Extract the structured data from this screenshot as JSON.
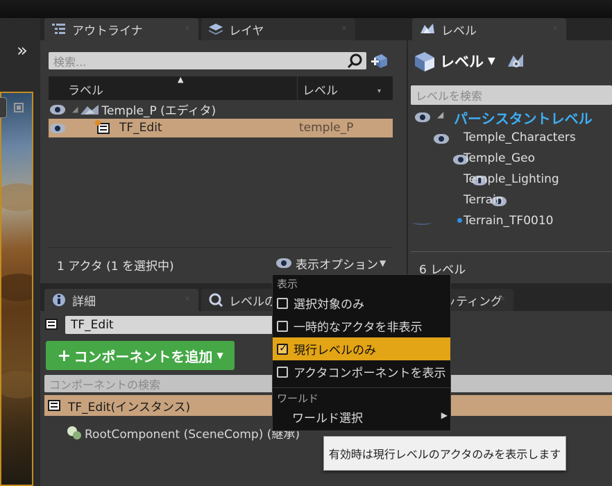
{
  "outliner": {
    "tab_label": "アウトライナ",
    "layers_tab_label": "レイヤ",
    "search_placeholder": "検索...",
    "columns": {
      "label": "ラベル",
      "level": "レベル"
    },
    "tree": {
      "root_label": "Temple_P (エディタ)",
      "selected_item": {
        "label": "TF_Edit",
        "level": "temple_P"
      }
    },
    "status_text": "1 アクタ (1 を選択中)",
    "view_options_label": "表示オプション"
  },
  "levels": {
    "tab_label": "レベル",
    "dropdown_label": "レベル",
    "search_placeholder": "レベルを検索",
    "persistent_level": "パーシスタントレベル",
    "items": [
      "Temple_Characters",
      "Temple_Geo",
      "Temple_Lighting",
      "Terrain",
      "Terrain_TF0010"
    ],
    "count_text": "6 レベル"
  },
  "details": {
    "tab_label": "詳細",
    "level_tab_label": "レベルの",
    "third_tab_label": "ッティング",
    "name_value": "TF_Edit",
    "add_component_label": "コンポーネントを追加",
    "component_search_placeholder": "コンポーネントの検索",
    "instance_label": "TF_Edit(インスタンス)",
    "root_component_label": "RootComponent (SceneComp) (継承)"
  },
  "view_options_menu": {
    "display_section": "表示",
    "items": [
      {
        "label": "選択対象のみ",
        "checked": false
      },
      {
        "label": "一時的なアクタを非表示",
        "checked": false
      },
      {
        "label": "現行レベルのみ",
        "checked": true
      },
      {
        "label": "アクタコンポーネントを表示",
        "checked": false
      }
    ],
    "world_section": "ワールド",
    "world_select_label": "ワールド選択"
  },
  "tooltip": {
    "text": "有効時は現行レベルのアクタのみを表示します"
  },
  "colors": {
    "highlight": "#e3a415",
    "selection_row": "#c7a27d",
    "add_component_green": "#45a746",
    "persistent_level_text": "#3eaef5",
    "level_dot": "#2f8fe6"
  }
}
